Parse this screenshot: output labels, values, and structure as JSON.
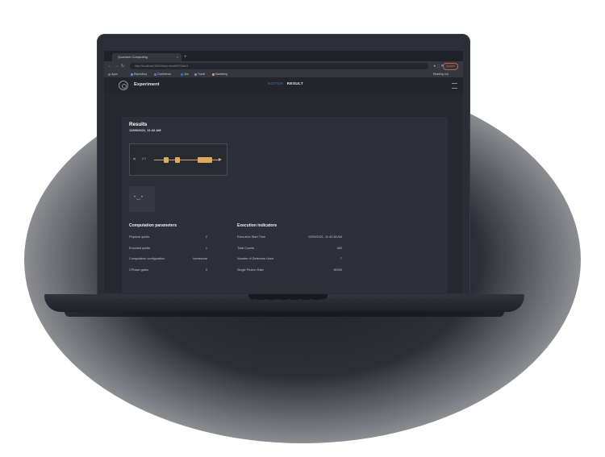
{
  "browser": {
    "tab_title": "Quantum Computing",
    "tab_close": "×",
    "new_tab": "+",
    "nav_back": "←",
    "nav_forward": "→",
    "nav_reload": "↻",
    "url": "http://localhost:3000/hazy-result/ZY0abc3",
    "update_label": "Update",
    "bookmarks": [
      {
        "label": "Apps",
        "color": "#6b6e76"
      },
      {
        "label": "Repository",
        "color": "#5b8fd6"
      },
      {
        "label": "Confluence",
        "color": "#3a7bd5"
      },
      {
        "label": "Jira",
        "color": "#2d6fd0"
      },
      {
        "label": "Travel",
        "color": "#5b8fd6"
      },
      {
        "label": "Marketing",
        "color": "#caa356"
      }
    ],
    "reading_list": "Reading List"
  },
  "app": {
    "title": "Experiment",
    "tabs": {
      "editor": "EDITOR",
      "result": "RESULT"
    }
  },
  "results": {
    "title": "Results",
    "date": "12/09/2021, 11:42 AM",
    "circuit_label_left": "a|",
    "circuit_label_mid": "|+⟩"
  },
  "computation": {
    "title": "Computation parameters",
    "rows": [
      {
        "label": "Physical qubits",
        "value": "2"
      },
      {
        "label": "Encoded qubits",
        "value": "1"
      },
      {
        "label": "Computation configuration",
        "value": "homeshoe"
      },
      {
        "label": "CPhase gates",
        "value": "0"
      }
    ]
  },
  "execution": {
    "title": "Execution indicators",
    "rows": [
      {
        "label": "Execution Start Time",
        "value": "12/09/2021, 11:42:36 AM"
      },
      {
        "label": "Total Counts",
        "value": "400"
      },
      {
        "label": "Number of Detectors Used",
        "value": "7"
      },
      {
        "label": "Single Photon Rate",
        "value": "50000"
      }
    ]
  },
  "colors": {
    "accent_gate": "#e0a95c",
    "tab_active": "#e6e7ea",
    "tab_inactive": "#3c5a8c",
    "update": "#d35c4e"
  }
}
